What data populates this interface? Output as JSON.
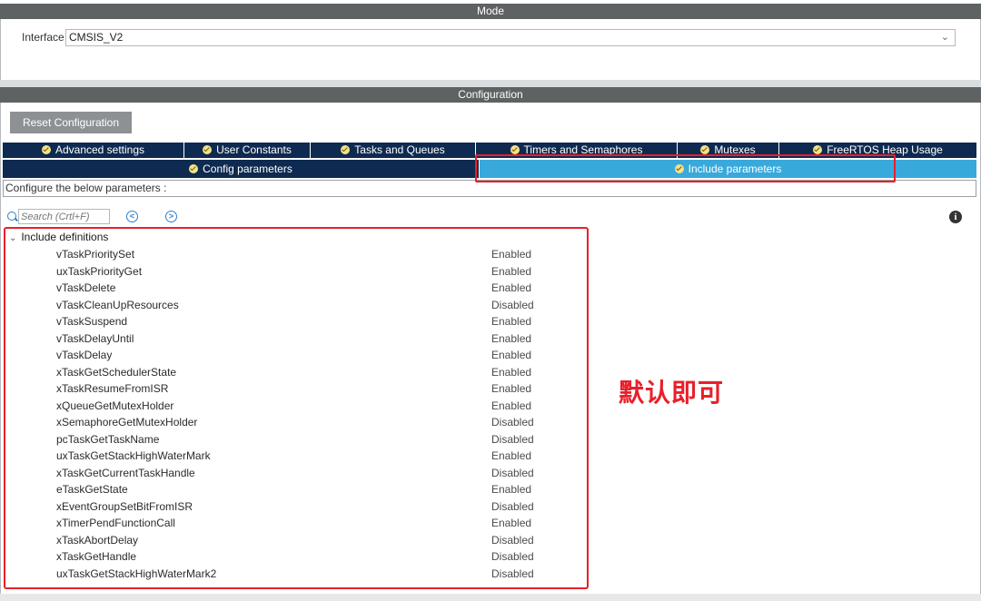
{
  "mode": {
    "header": "Mode",
    "interface_label": "Interface",
    "interface_value": "CMSIS_V2"
  },
  "configuration": {
    "header": "Configuration",
    "reset_button": "Reset Configuration"
  },
  "tabs_row1": [
    {
      "label": "Advanced settings"
    },
    {
      "label": "User Constants"
    },
    {
      "label": "Tasks and Queues"
    },
    {
      "label": "Timers and Semaphores"
    },
    {
      "label": "Mutexes"
    },
    {
      "label": "FreeRTOS Heap Usage"
    }
  ],
  "tabs_row2": [
    {
      "label": "Config parameters",
      "active": false
    },
    {
      "label": "Include parameters",
      "active": true
    }
  ],
  "configure_text": "Configure the below parameters :",
  "search": {
    "placeholder": "Search (Crtl+F)"
  },
  "tree": {
    "group_label": "Include definitions",
    "rows": [
      {
        "name": "vTaskPrioritySet",
        "value": "Enabled"
      },
      {
        "name": "uxTaskPriorityGet",
        "value": "Enabled"
      },
      {
        "name": "vTaskDelete",
        "value": "Enabled"
      },
      {
        "name": "vTaskCleanUpResources",
        "value": "Disabled"
      },
      {
        "name": "vTaskSuspend",
        "value": "Enabled"
      },
      {
        "name": "vTaskDelayUntil",
        "value": "Enabled"
      },
      {
        "name": "vTaskDelay",
        "value": "Enabled"
      },
      {
        "name": "xTaskGetSchedulerState",
        "value": "Enabled"
      },
      {
        "name": "xTaskResumeFromISR",
        "value": "Enabled"
      },
      {
        "name": "xQueueGetMutexHolder",
        "value": "Enabled"
      },
      {
        "name": "xSemaphoreGetMutexHolder",
        "value": "Disabled"
      },
      {
        "name": "pcTaskGetTaskName",
        "value": "Disabled"
      },
      {
        "name": "uxTaskGetStackHighWaterMark",
        "value": "Enabled"
      },
      {
        "name": "xTaskGetCurrentTaskHandle",
        "value": "Disabled"
      },
      {
        "name": "eTaskGetState",
        "value": "Enabled"
      },
      {
        "name": "xEventGroupSetBitFromISR",
        "value": "Disabled"
      },
      {
        "name": "xTimerPendFunctionCall",
        "value": "Enabled"
      },
      {
        "name": "xTaskAbortDelay",
        "value": "Disabled"
      },
      {
        "name": "xTaskGetHandle",
        "value": "Disabled"
      },
      {
        "name": "uxTaskGetStackHighWaterMark2",
        "value": "Disabled"
      }
    ]
  },
  "annotation": "默认即可",
  "colors": {
    "accent_red": "#e8202a",
    "active_tab": "#39a9dc",
    "tab_bg": "#0f2a50"
  },
  "icons": [
    "search-icon",
    "previous-icon",
    "next-icon",
    "info-icon",
    "check-icon",
    "chevron-down-icon"
  ]
}
